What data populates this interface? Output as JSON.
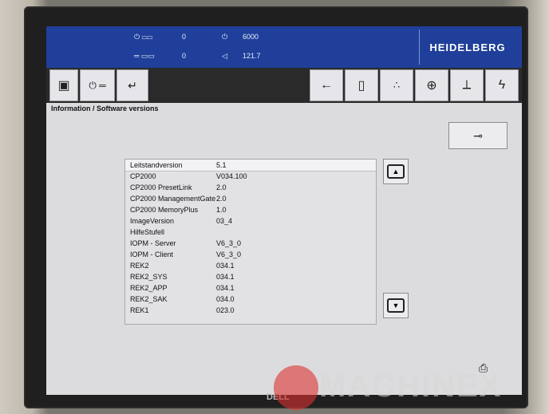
{
  "header": {
    "row1": {
      "value_a": "0",
      "value_b": "6000"
    },
    "row2": {
      "value_a": "0",
      "value_b": "121.7"
    },
    "brand": "HEIDELBERG"
  },
  "breadcrumb": "Information / Software versions",
  "table": {
    "rows": [
      {
        "key": "Leitstandversion",
        "value": "5.1"
      },
      {
        "key": "CP2000",
        "value": "V034.100"
      },
      {
        "key": "CP2000 PresetLink",
        "value": "2.0"
      },
      {
        "key": "CP2000 ManagementGate",
        "value": "2.0"
      },
      {
        "key": "CP2000 MemoryPlus",
        "value": "1.0"
      },
      {
        "key": "ImageVersion",
        "value": "03_4"
      },
      {
        "key": "HilfeStufell",
        "value": ""
      },
      {
        "key": "IOPM - Server",
        "value": "V6_3_0"
      },
      {
        "key": "IOPM - Client",
        "value": "V6_3_0"
      },
      {
        "key": "REK2",
        "value": "034.1"
      },
      {
        "key": "REK2_SYS",
        "value": "034.1"
      },
      {
        "key": "REK2_APP",
        "value": "034.1"
      },
      {
        "key": "REK2_SAK",
        "value": "034.0"
      },
      {
        "key": "REK1",
        "value": "023.0"
      }
    ]
  },
  "watermark": "MACHINEX",
  "monitor_brand": "DELL",
  "colors": {
    "topbar": "#1f3f9a",
    "screen_bg": "#dcdcdf"
  },
  "icons": {
    "key": "key-icon",
    "up": "scroll-up-icon",
    "down": "scroll-down-icon",
    "print": "print-icon"
  }
}
